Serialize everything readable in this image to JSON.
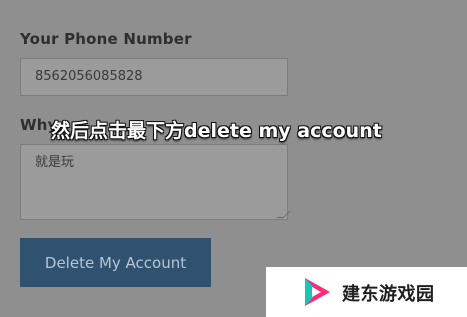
{
  "form": {
    "phone_label": "Your Phone Number",
    "phone_value": "8562056085828",
    "why_label": "Why",
    "reason_value": "就是玩",
    "delete_button_label": "Delete My Account"
  },
  "overlay": {
    "subtitle": "然后点击最下方delete my account"
  },
  "watermark": {
    "brand_text": "建东游戏园",
    "brand_colors": [
      "#ff2b7a",
      "#14c7b8",
      "#ffffff"
    ]
  }
}
